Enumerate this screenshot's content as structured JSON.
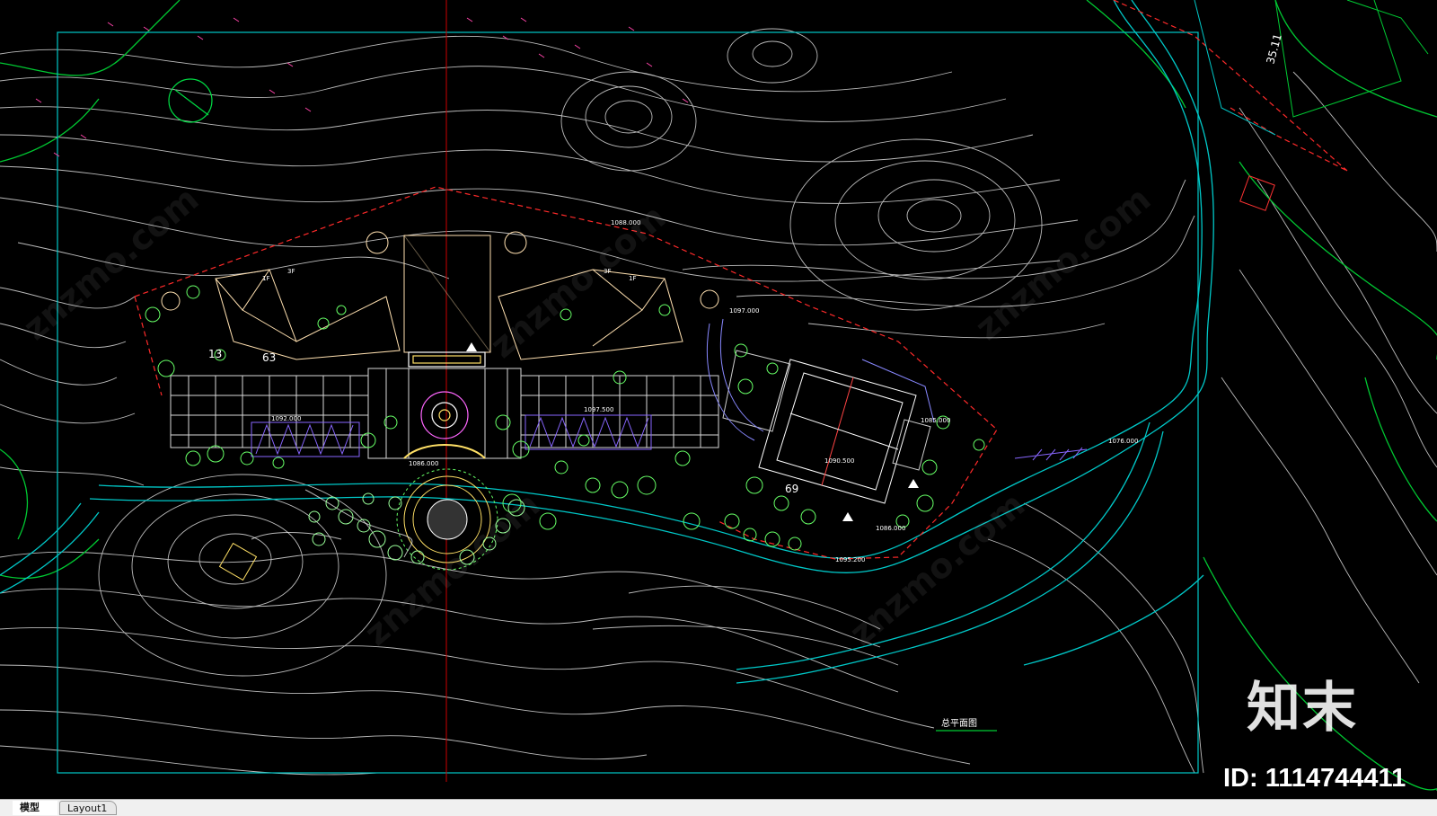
{
  "drawing": {
    "title_label": "总平面图",
    "elevations": [
      "1097.000",
      "1092.000",
      "1097.500",
      "1085.000",
      "1076.000",
      "1090.500",
      "1086.000",
      "1086.000",
      "1095.200",
      "1088.000"
    ],
    "floor_labels": [
      "1F",
      "3F",
      "3F",
      "1F"
    ],
    "numbers": [
      "63",
      "35.11",
      "69",
      "13"
    ],
    "colors": {
      "background": "#000000",
      "contour": "#e8e8e8",
      "frame": "#00cccc",
      "boundary": "#ff2a2a",
      "axis": "#cc0000",
      "road": "#00cccc",
      "terrain_green": "#00cc33",
      "building": "#ffe0b0",
      "vegetation": "#66ff66",
      "court": "#ffffff",
      "walk": "#ff00ff",
      "annotation": "#ffff00"
    }
  },
  "watermark": {
    "logo": "知末",
    "id": "ID: 1114744411"
  },
  "tabs": [
    {
      "label": "模型",
      "active": true
    },
    {
      "label": "Layout1",
      "active": false
    }
  ]
}
